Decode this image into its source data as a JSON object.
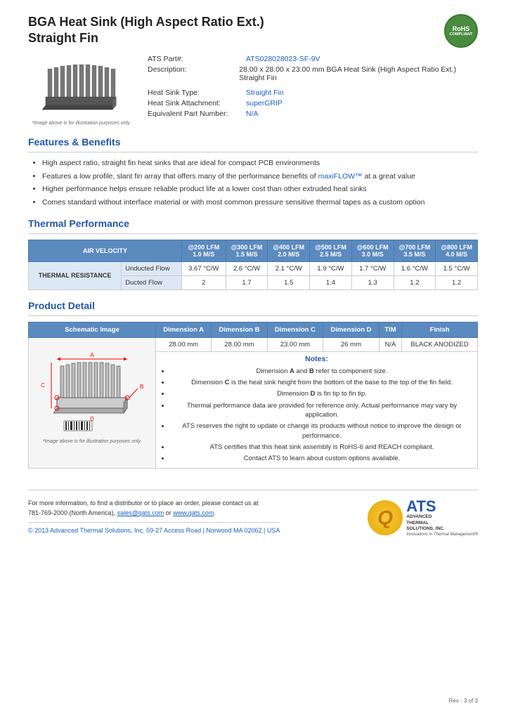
{
  "page": {
    "title_line1": "BGA Heat Sink (High Aspect Ratio Ext.)",
    "title_line2": "Straight Fin",
    "image_caption": "*Image above is for illustration purposes only",
    "schematic_caption": "*Image above is for illustration purposes only."
  },
  "rohs": {
    "line1": "RoHS",
    "line2": "COMPLIANT"
  },
  "specs": {
    "part_label": "ATS Part#:",
    "part_value": "ATS028028023-SF-9V",
    "desc_label": "Description:",
    "desc_value": "28.00 x 28.00 x 23.00 mm  BGA Heat Sink (High Aspect Ratio Ext.) Straight Fin",
    "type_label": "Heat Sink Type:",
    "type_value": "Straight Fin",
    "attach_label": "Heat Sink Attachment:",
    "attach_value": "superGRIP",
    "equiv_label": "Equivalent Part Number:",
    "equiv_value": "N/A"
  },
  "features": {
    "section_title": "Features & Benefits",
    "items": [
      "High aspect ratio, straight fin heat sinks that are ideal for compact PCB environments",
      "Features a low profile, slant fin array that offers many of the performance benefits of maxiFLOW™ at a great value",
      "Higher performance helps ensure reliable product life at a lower cost than other extruded heat sinks",
      "Comes standard without interface material or with most common pressure sensitive thermal tapes as a custom option"
    ],
    "maxiflow_link": "maxiFLOW™"
  },
  "thermal_performance": {
    "section_title": "Thermal Performance",
    "table": {
      "air_vel_header": "AIR VELOCITY",
      "col_headers": [
        "@200 LFM\n1.0 M/S",
        "@300 LFM\n1.5 M/S",
        "@400 LFM\n2.0 M/S",
        "@500 LFM\n2.5 M/S",
        "@600 LFM\n3.0 M/S",
        "@700 LFM\n3.5 M/S",
        "@800 LFM\n4.0 M/S"
      ],
      "row_label": "THERMAL RESISTANCE",
      "rows": [
        {
          "label": "Unducted Flow",
          "values": [
            "3.67 °C/W",
            "2.6 °C/W",
            "2.1 °C/W",
            "1.9 °C/W",
            "1.7 °C/W",
            "1.6 °C/W",
            "1.5 °C/W"
          ]
        },
        {
          "label": "Ducted Flow",
          "values": [
            "2",
            "1.7",
            "1.5",
            "1.4",
            "1.3",
            "1.2",
            "1.2"
          ]
        }
      ]
    }
  },
  "product_detail": {
    "section_title": "Product Detail",
    "table_headers": [
      "Schematic Image",
      "Dimension A",
      "Dimension B",
      "Dimension C",
      "Dimension D",
      "TIM",
      "Finish"
    ],
    "dim_values": [
      "28.00 mm",
      "28.00 mm",
      "23.00 mm",
      "26 mm",
      "N/A",
      "BLACK ANODIZED"
    ],
    "notes_title": "Notes:",
    "notes": [
      "Dimension A and B refer to component size.",
      "Dimension C is the heat sink height from the bottom of the base to the top of the fin field.",
      "Dimension D is fin tip to fin tip.",
      "Thermal performance data are provided for reference only. Actual performance may vary by application.",
      "ATS reserves the right to update or change its products without notice to improve the design or performance.",
      "ATS certifies that this heat sink assembly is RoHS-6 and REACH compliant.",
      "Contact ATS to learn about custom options available."
    ]
  },
  "footer": {
    "contact_text": "For more information, to find a distributor or to place an order, please contact us at",
    "phone": "781-769-2000 (North America),",
    "email": "sales@qats.com",
    "email_or": "or",
    "website": "www.qats.com",
    "copyright": "© 2013 Advanced Thermal Solutions, Inc.",
    "address": "59-27 Access Road  |  Norwood MA  02062  |  USA",
    "page_num": "Rev - 3 of 3",
    "ats_q": "Q",
    "ats_letters": "ATS",
    "ats_name_line1": "ADVANCED",
    "ats_name_line2": "THERMAL",
    "ats_name_line3": "SOLUTIONS, INC.",
    "ats_tagline": "Innovations in Thermal Management®"
  }
}
